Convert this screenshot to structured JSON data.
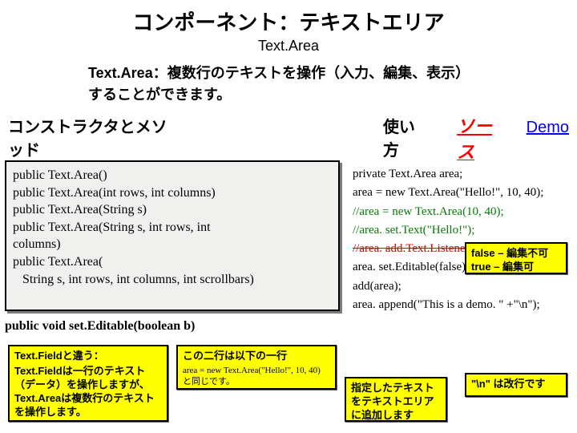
{
  "title": "コンポーネント：テキストエリア",
  "subtitle": "Text.Area",
  "desc_label": "Text.Area：",
  "desc_body1": "複数行のテキストを操作（入力、編集、表示）",
  "desc_body2": "することができます。",
  "heads": {
    "left": "コンストラクタとメソッド",
    "mid": "使い方",
    "src": "ソース",
    "demo": "Demo"
  },
  "sigs": {
    "s1": "public Text.Area()",
    "s2": "public Text.Area(int rows, int columns)",
    "s3": "public Text.Area(String s)",
    "s4a": "public Text.Area(String s, int rows, int",
    "s4b": "columns)",
    "s5a": "public Text.Area(",
    "s5b": "String s, int rows, int columns, int scrollbars)",
    "se": "public void set.Editable(boolean b)"
  },
  "usage": {
    "u1": "private Text.Area area;",
    "u2": "area = new Text.Area(\"Hello!\", 10, 40);",
    "u3": "//area = new Text.Area(10, 40);",
    "u4": "//area. set.Text(\"Hello!\");",
    "u5": "//area. add.Text.Listener(this);",
    "u6": "area. set.Editable(false);",
    "u7": "add(area);",
    "u8": "area. append(\"This is a demo. \" +\"\\n\");"
  },
  "note1": {
    "t": "Text.Fieldと違う：",
    "b": "Text.Fieldは一行のテキスト（データ）を操作しますが、Text.Areaは複数行のテキストを操作します。"
  },
  "note2": {
    "t": "この二行は以下の一行",
    "b": "area = new Text.Area(\"Hello!\", 10, 40) と同じです。"
  },
  "note3": {
    "b": "指定したテキストをテキストエリアに追加します"
  },
  "note4": {
    "l1": "false – 編集不可",
    "l2": "true – 編集可"
  },
  "note5": {
    "b": "\"\\n\" は改行です"
  }
}
